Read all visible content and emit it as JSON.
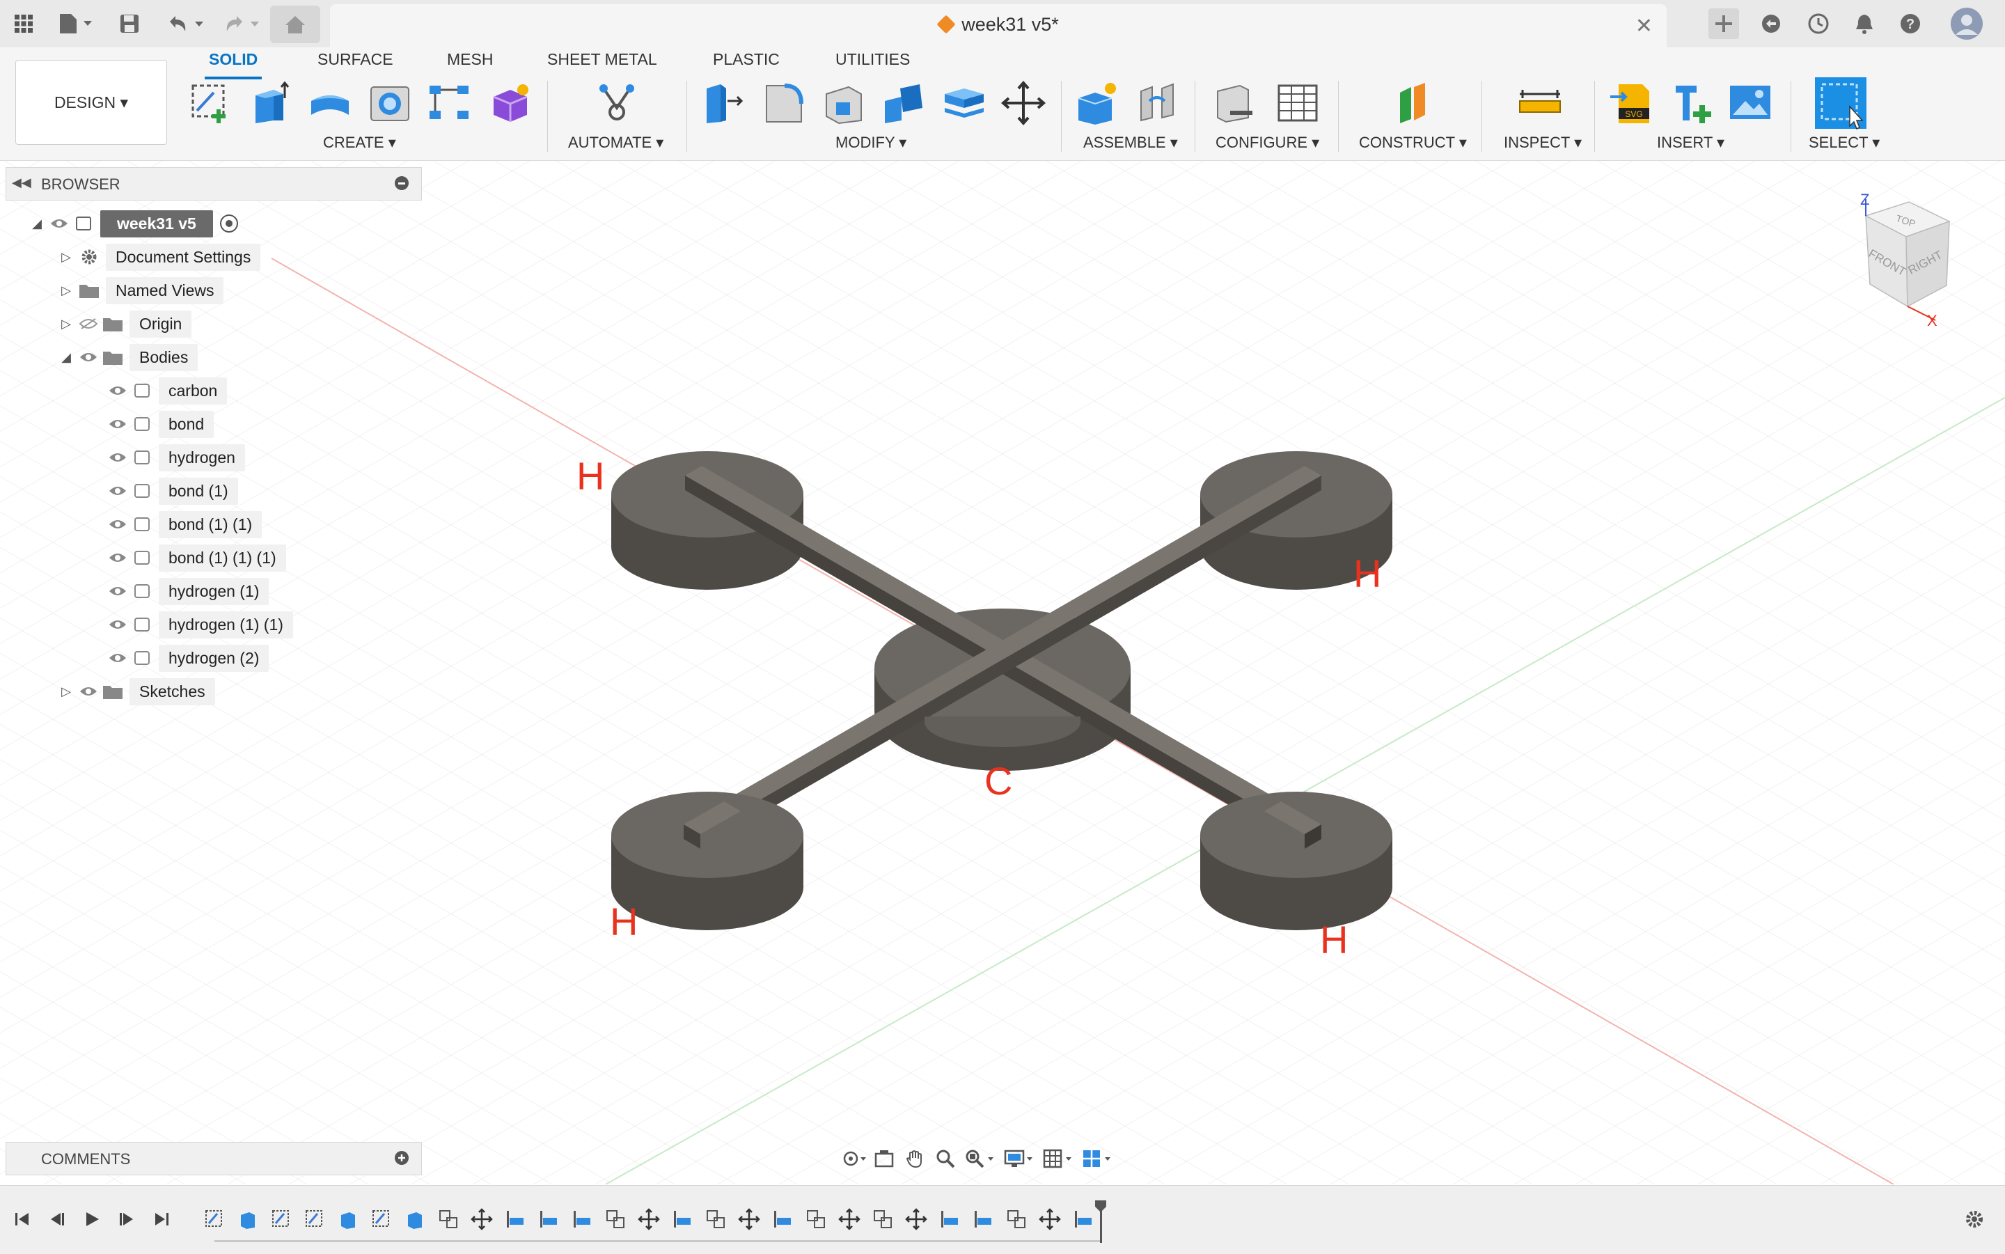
{
  "titlebar": {
    "doc_title": "week31 v5*"
  },
  "ribbon": {
    "workspace_button": "DESIGN ▾",
    "tabs": [
      "SOLID",
      "SURFACE",
      "MESH",
      "SHEET METAL",
      "PLASTIC",
      "UTILITIES"
    ],
    "active_tab": "SOLID",
    "groups": [
      "CREATE ▾",
      "AUTOMATE ▾",
      "MODIFY ▾",
      "ASSEMBLE ▾",
      "CONFIGURE ▾",
      "CONSTRUCT ▾",
      "INSPECT ▾",
      "INSERT ▾",
      "SELECT ▾"
    ]
  },
  "browser": {
    "header": "BROWSER",
    "root": "week31 v5",
    "items": [
      {
        "label": "Document Settings"
      },
      {
        "label": "Named Views"
      },
      {
        "label": "Origin"
      },
      {
        "label": "Bodies"
      },
      {
        "label": "carbon"
      },
      {
        "label": "bond"
      },
      {
        "label": "hydrogen"
      },
      {
        "label": "bond (1)"
      },
      {
        "label": "bond (1) (1)"
      },
      {
        "label": "bond (1) (1) (1)"
      },
      {
        "label": "hydrogen (1)"
      },
      {
        "label": "hydrogen (1) (1)"
      },
      {
        "label": "hydrogen (2)"
      },
      {
        "label": "Sketches"
      }
    ]
  },
  "comments": {
    "header": "COMMENTS"
  },
  "viewcube": {
    "top": "TOP",
    "front": "FRONT",
    "right": "RIGHT",
    "axis_z": "Z",
    "axis_x": "X"
  },
  "model_labels": {
    "h_top_left": "H",
    "h_top_right": "H",
    "h_bottom_left": "H",
    "h_bottom_right": "H",
    "c_center": "C"
  },
  "colors": {
    "accent": "#0a74c4",
    "model_top": "#6b6762",
    "model_side": "#4e4a46",
    "label_red": "#e8321e"
  }
}
